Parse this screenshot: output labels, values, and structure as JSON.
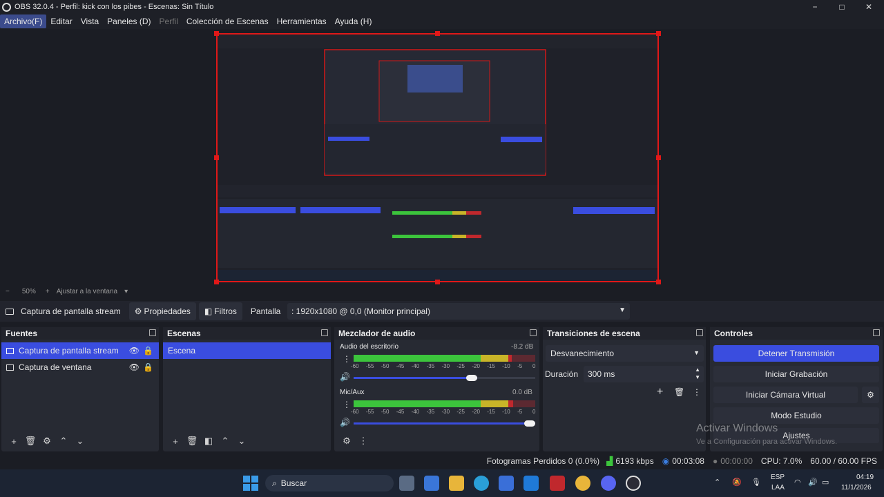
{
  "window": {
    "title": "OBS 32.0.4 - Perfil: kick con los pibes - Escenas: Sin Título",
    "minimize": "−",
    "maximize": "□",
    "close": "✕"
  },
  "menu": {
    "items": [
      "Archivo(F)",
      "Editar",
      "Vista",
      "Paneles (D)",
      "Perfil",
      "Colección de Escenas",
      "Herramientas",
      "Ayuda (H)"
    ]
  },
  "zoom": {
    "minus": "−",
    "value": "50%",
    "plus": "+",
    "fit_label": "Ajustar a la ventana"
  },
  "source_toolbar": {
    "source_name": "Captura de pantalla stream",
    "properties_label": "Propiedades",
    "filters_label": "Filtros",
    "display_label": "Pantalla",
    "display_value": ": 1920x1080 @ 0,0 (Monitor principal)"
  },
  "sources": {
    "title": "Fuentes",
    "items": [
      {
        "name": "Captura de pantalla stream",
        "selected": true
      },
      {
        "name": "Captura de ventana",
        "selected": false
      }
    ]
  },
  "scenes": {
    "title": "Escenas",
    "items": [
      {
        "name": "Escena",
        "selected": true
      }
    ]
  },
  "mixer": {
    "title": "Mezclador de audio",
    "channels": [
      {
        "name": "Audio del escritorio",
        "db": "-8.2 dB",
        "level": 0.87,
        "volume": 0.68
      },
      {
        "name": "Mic/Aux",
        "db": "0.0 dB",
        "level": 0.88,
        "volume": 1.0
      }
    ],
    "scale": [
      "-60",
      "-55",
      "-50",
      "-45",
      "-40",
      "-35",
      "-30",
      "-25",
      "-20",
      "-15",
      "-10",
      "-5",
      "0"
    ]
  },
  "transitions": {
    "title": "Transiciones de escena",
    "selected": "Desvanecimiento",
    "duration_label": "Duración",
    "duration_value": "300 ms"
  },
  "controls": {
    "title": "Controles",
    "buttons": [
      "Detener Transmisión",
      "Iniciar Grabación",
      "Iniciar Cámara Virtual",
      "Modo Estudio",
      "Ajustes"
    ]
  },
  "watermark": {
    "line1": "Activar Windows",
    "line2": "Ve a Configuración para activar Windows."
  },
  "status": {
    "dropped_frames": "Fotogramas Perdidos 0 (0.0%)",
    "bitrate": "6193 kbps",
    "stream_time": "00:03:08",
    "record_time": "00:00:00",
    "cpu": "CPU: 7.0%",
    "fps": "60.00 / 60.00 FPS"
  },
  "taskbar": {
    "search_label": "Buscar",
    "lang_top": "ESP",
    "lang_bottom": "LAA",
    "time": "04:19",
    "date": "11/1/2026"
  },
  "colors": {
    "accent": "#3a4ddf",
    "red_border": "#e01818",
    "meter_green": "#3cc43c",
    "meter_yellow": "#c8b428",
    "meter_red": "#c0282d"
  }
}
